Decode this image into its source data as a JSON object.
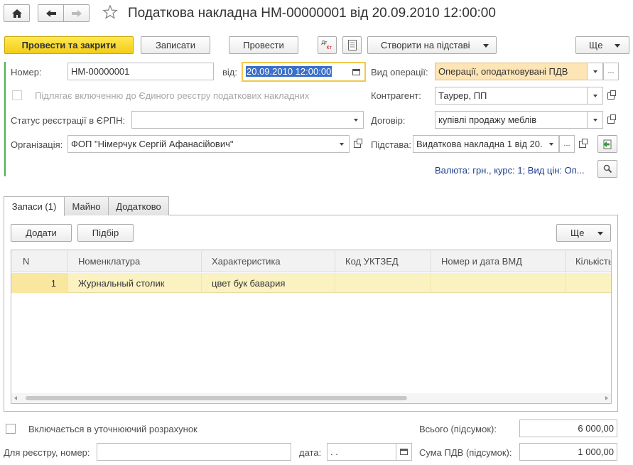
{
  "window": {
    "title": "Податкова накладна НМ-00000001 від 20.09.2010 12:00:00"
  },
  "toolbar": {
    "post_close": "Провести та закрити",
    "save": "Записати",
    "post": "Провести",
    "create_based": "Створити на підставі",
    "more": "Ще",
    "dt_kt_icon_text": "Дт Кт"
  },
  "form": {
    "number_label": "Номер:",
    "number_value": "НМ-00000001",
    "date_label": "від:",
    "date_value": "20.09.2010 12:00:00",
    "operation_label": "Вид операції:",
    "operation_value": "Операції, оподатковувані ПДВ",
    "unified_register_label": "Підлягає включенню до Єдиного реєстру податкових накладних",
    "counterparty_label": "Контрагент:",
    "counterparty_value": "Таурер, ПП",
    "status_label": "Статус реєстрації в ЄРПН:",
    "status_value": "",
    "contract_label": "Договір:",
    "contract_value": "купівлі продажу меблів",
    "organization_label": "Організація:",
    "organization_value": "ФОП \"Німерчук Сергій Афанасійович\"",
    "basis_label": "Підстава:",
    "basis_value": "Видаткова накладна 1 від 20.",
    "currency_info": "Валюта: грн., курс: 1; Вид цін: Оп..."
  },
  "tabs": [
    {
      "label": "Запаси (1)"
    },
    {
      "label": "Майно"
    },
    {
      "label": "Додатково"
    }
  ],
  "table_toolbar": {
    "add": "Додати",
    "select": "Підбір",
    "more": "Ще"
  },
  "table": {
    "columns": [
      "N",
      "Номенклатура",
      "Характеристика",
      "Код УКТЗЕД",
      "Номер и дата ВМД",
      "Кількість"
    ],
    "rows": [
      [
        "1",
        "Журнальный столик",
        "цвет бук бавария",
        "",
        "",
        ""
      ]
    ]
  },
  "footer": {
    "included_label": "Включається в уточнюючий розрахунок",
    "total_label": "Всього (підсумок):",
    "total_value": "6 000,00",
    "register_number_label": "Для реєстру, номер:",
    "register_number_value": "",
    "date_label": "дата:",
    "date_value": " .  .",
    "vat_label": "Сума ПДВ (підсумок):",
    "vat_value": "1 000,00"
  }
}
